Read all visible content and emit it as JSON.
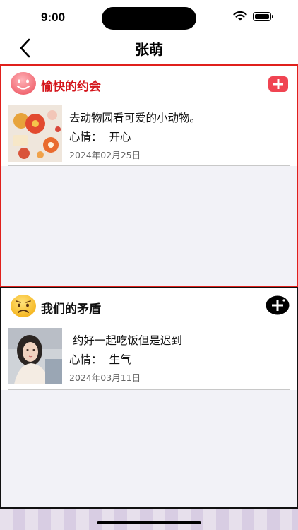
{
  "status": {
    "time": "9:00"
  },
  "nav": {
    "title": "张萌"
  },
  "panels": [
    {
      "title": "愉快的约会",
      "entry": {
        "text": "去动物园看可爱的小动物。",
        "mood_label": "心情：",
        "mood_value": "开心",
        "date": "2024年02月25日"
      },
      "accent": "#e0201c"
    },
    {
      "title": "我们的矛盾",
      "entry": {
        "text": " 约好一起吃饭但是迟到",
        "mood_label": "心情：",
        "mood_value": "生气",
        "date": "2024年03月11日"
      },
      "accent": "#111111"
    }
  ],
  "icons": {
    "back": "chevron-left-icon",
    "happy": "smiley-face-icon",
    "sad": "sad-face-icon",
    "add": "plus-icon"
  }
}
